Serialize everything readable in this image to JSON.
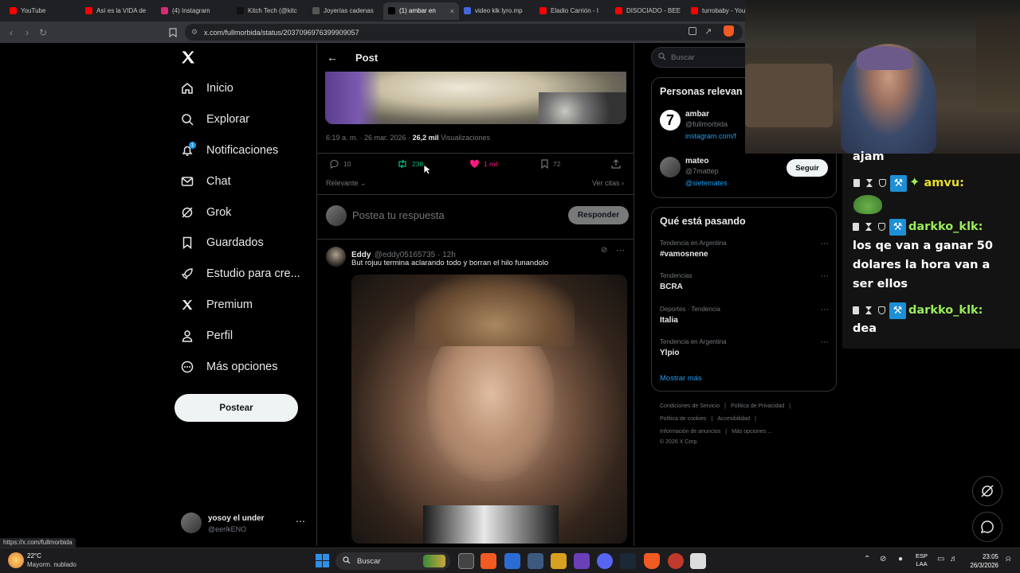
{
  "browser": {
    "tabs": [
      {
        "label": "YouTube",
        "color": "#ff0000"
      },
      {
        "label": "Así es la VIDA de",
        "color": "#ff0000"
      },
      {
        "label": "(4) Instagram",
        "color": "#d62976"
      },
      {
        "label": "Kitch Tech (@kitc",
        "color": "#111111"
      },
      {
        "label": "Joyerías cadenas",
        "color": "#555555"
      },
      {
        "label": "(1) ambar en",
        "color": "#000000",
        "active": true
      },
      {
        "label": "video klk lyro.mp",
        "color": "#4466dd"
      },
      {
        "label": "Eladio Carrión - I",
        "color": "#ff0000"
      },
      {
        "label": "DISOCIADO - BEE",
        "color": "#ff0000"
      },
      {
        "label": "turrobaby - You",
        "color": "#ff0000"
      }
    ],
    "url": "x.com/fullmorbida/status/2037096976399909057",
    "status_url": "https://x.com/fullmorbida"
  },
  "nav": {
    "logo": "X",
    "items": [
      {
        "label": "Inicio",
        "icon": "home-icon"
      },
      {
        "label": "Explorar",
        "icon": "search-icon"
      },
      {
        "label": "Notificaciones",
        "icon": "bell-icon",
        "badge": "1"
      },
      {
        "label": "Chat",
        "icon": "mail-icon"
      },
      {
        "label": "Grok",
        "icon": "grok-icon"
      },
      {
        "label": "Guardados",
        "icon": "bookmark-icon"
      },
      {
        "label": "Estudio para cre...",
        "icon": "rocket-icon"
      },
      {
        "label": "Premium",
        "icon": "x-premium-icon"
      },
      {
        "label": "Perfil",
        "icon": "person-icon"
      },
      {
        "label": "Más opciones",
        "icon": "more-circle-icon"
      }
    ],
    "post_button": "Postear",
    "account": {
      "name": "yosoy el under",
      "handle": "@eerlkENO"
    }
  },
  "post": {
    "header_title": "Post",
    "time": "6:19 a. m. · 26 mar. 2026 · ",
    "views_count": "26,2 mil",
    "views_label": " Visualizaciones",
    "replies": "10",
    "reposts": "238",
    "likes": "1 mil",
    "bookmarks": "72",
    "sort_label": "Relevante",
    "quotes_label": "Ver citas",
    "reply_placeholder": "Postea tu respuesta",
    "reply_button": "Responder"
  },
  "reply_tweet": {
    "name": "Eddy",
    "handle": "@eddy05165735 · 12h",
    "text": "But rojuu termina aclarando todo y borran el hilo funandolo"
  },
  "sidebar": {
    "search_placeholder": "Buscar",
    "relevant_title": "Personas relevan",
    "people": [
      {
        "name": "ambar",
        "handle": "@fullmorbida",
        "link": "instagram.com/f"
      },
      {
        "name": "mateo",
        "handle": "@7mattep",
        "link": "@sietemates"
      }
    ],
    "follow_button": "Seguir",
    "trends_title": "Qué está pasando",
    "trends": [
      {
        "category": "Tendencia en Argentina",
        "name": "#vamosnene"
      },
      {
        "category": "Tendencias",
        "name": "BCRA"
      },
      {
        "category": "Deportes · Tendencia",
        "name": "Italia"
      },
      {
        "category": "Tendencia en Argentina",
        "name": "Ylpio"
      }
    ],
    "show_more": "Mostrar más",
    "footer": [
      [
        "Condiciones de Servicio",
        "|",
        "Política de Privacidad",
        "|"
      ],
      [
        "Política de cookies",
        "|",
        "Accesibilidad",
        "|"
      ],
      [
        "Información de anuncios",
        "|",
        "Más opciones ..."
      ],
      [
        "© 2026 X Corp."
      ]
    ]
  },
  "chat": {
    "lines": [
      {
        "text": "ajam"
      },
      {
        "user": "amvu:",
        "emote": "frog"
      },
      {
        "user": "darkko_klk:",
        "message": "los qe van a ganar 50 dolares la hora van a ser ellos"
      },
      {
        "user": "darkko_klk:",
        "message": "dea"
      }
    ]
  },
  "taskbar": {
    "weather_temp": "22°C",
    "weather_desc": "Mayorm. nublado",
    "search_placeholder": "Buscar",
    "lang_top": "ESP",
    "lang_bottom": "LAA",
    "time": "23:05",
    "date": "26/3/2026"
  }
}
